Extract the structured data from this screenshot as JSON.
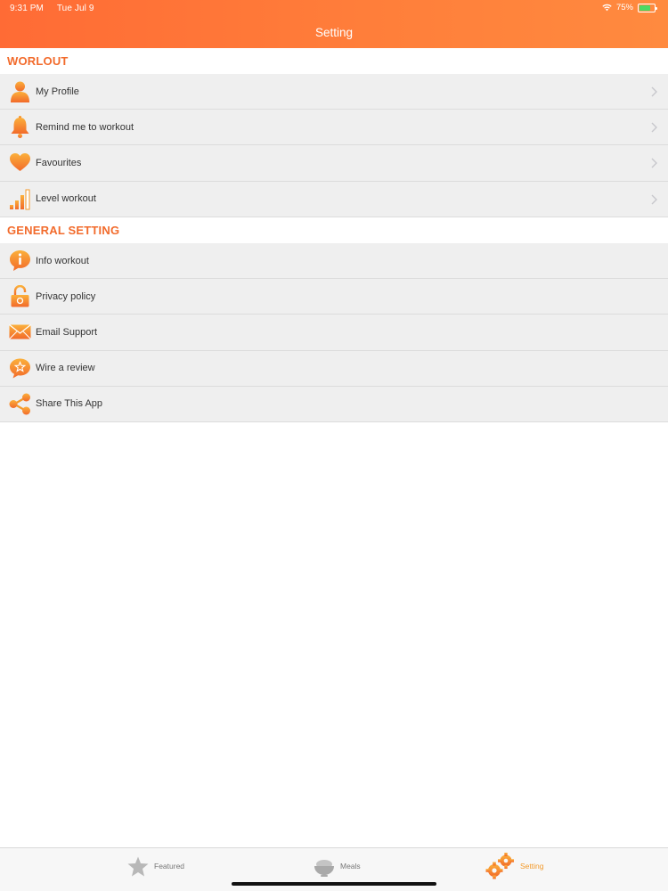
{
  "status_bar": {
    "time": "9:31 PM",
    "date": "Tue Jul 9",
    "battery_percent": "75%",
    "battery_level": 0.75
  },
  "header": {
    "title": "Setting"
  },
  "sections": {
    "workout": {
      "title": "WORLOUT",
      "items": [
        {
          "label": "My Profile",
          "icon": "profile-icon"
        },
        {
          "label": "Remind me to workout",
          "icon": "bell-icon"
        },
        {
          "label": "Favourites",
          "icon": "heart-icon"
        },
        {
          "label": "Level workout",
          "icon": "level-bars-icon"
        }
      ]
    },
    "general": {
      "title": "GENERAL SETTING",
      "items": [
        {
          "label": "Info workout",
          "icon": "info-bubble-icon"
        },
        {
          "label": "Privacy policy",
          "icon": "lock-icon"
        },
        {
          "label": "Email Support",
          "icon": "envelope-icon"
        },
        {
          "label": "Wire a review",
          "icon": "review-star-bubble-icon"
        },
        {
          "label": "Share This App",
          "icon": "share-icon"
        }
      ]
    }
  },
  "tabbar": {
    "featured": {
      "label": "Featured",
      "icon": "star-icon"
    },
    "meals": {
      "label": "Meals",
      "icon": "bowl-icon"
    },
    "setting": {
      "label": "Setting",
      "icon": "gears-icon",
      "active": true
    }
  },
  "colors": {
    "accent": "#f26b2c",
    "header_gradient_start": "#ff6b35",
    "header_gradient_end": "#ff8a3f",
    "row_background": "#efefef",
    "icon_orange": "#f39a2b",
    "battery_green": "#4cd964"
  }
}
